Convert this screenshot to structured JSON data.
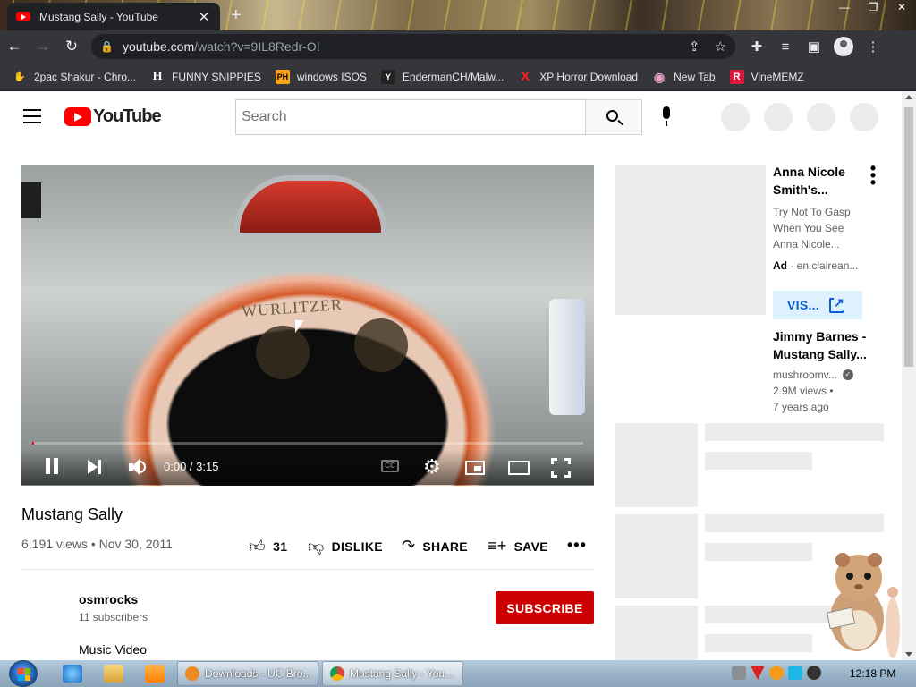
{
  "browser": {
    "tab_title": "Mustang Sally - YouTube",
    "tab_close": "✕",
    "new_tab": "+",
    "url_host": "youtube.com",
    "url_path": "/watch?v=9IL8Redr-OI",
    "window_controls": [
      "—",
      "❐",
      "✕"
    ],
    "bookmarks": [
      {
        "label": "2pac Shakur - Chro...",
        "icon": "hand-icon",
        "color": "#b85c2a",
        "glyph": "✋"
      },
      {
        "label": "FUNNY SNIPPIES",
        "icon": "h-icon",
        "color": "#ffffff",
        "glyph": "H"
      },
      {
        "label": "windows ISOS",
        "icon": "ph-icon",
        "color": "#ffa31a",
        "glyph": "PH"
      },
      {
        "label": "EndermanCH/Malw...",
        "icon": "yp-icon",
        "color": "#333333",
        "glyph": "Y"
      },
      {
        "label": "XP Horror Download",
        "icon": "x-icon",
        "color": "#ff2020",
        "glyph": "X"
      },
      {
        "label": "New Tab",
        "icon": "globe-icon",
        "color": "#c060a0",
        "glyph": "◉"
      },
      {
        "label": "VineMEMZ",
        "icon": "r-icon",
        "color": "#d91a3c",
        "glyph": "R"
      }
    ]
  },
  "youtube": {
    "logo_text": "YouTube",
    "search_placeholder": "Search",
    "video": {
      "time": "0:00 / 3:15",
      "progress_fraction": 0.003,
      "title": "Mustang Sally",
      "views_date": "6,191 views • Nov 30, 2011",
      "likes": "31",
      "dislike_label": "DISLIKE",
      "share_label": "SHARE",
      "save_label": "SAVE",
      "more_label": "•••",
      "channel": "osmrocks",
      "subscribers": "11 subscribers",
      "subscribe_label": "SUBSCRIBE",
      "category": "Music Video"
    },
    "sidebar": {
      "ad": {
        "title": "Anna Nicole Smith's...",
        "description": "Try Not To Gasp When You See Anna Nicole...",
        "badge": "Ad",
        "domain": "en.clairean...",
        "visit_label": "VIS..."
      },
      "recommendation": {
        "title": "Jimmy Barnes - Mustang Sally...",
        "channel": "mushroomv...",
        "views": "2.9M views •",
        "age": "7 years ago"
      }
    }
  },
  "taskbar": {
    "tasks": [
      {
        "label": "Downloads - UC Bro...",
        "color": "#f08a24"
      },
      {
        "label": "Mustang Sally - You...",
        "color": "#4caf50"
      }
    ],
    "clock": "12:18 PM"
  },
  "colors": {
    "youtube_red": "#ff0000",
    "subscribe_red": "#cc0000",
    "link_blue": "#065fd4"
  }
}
